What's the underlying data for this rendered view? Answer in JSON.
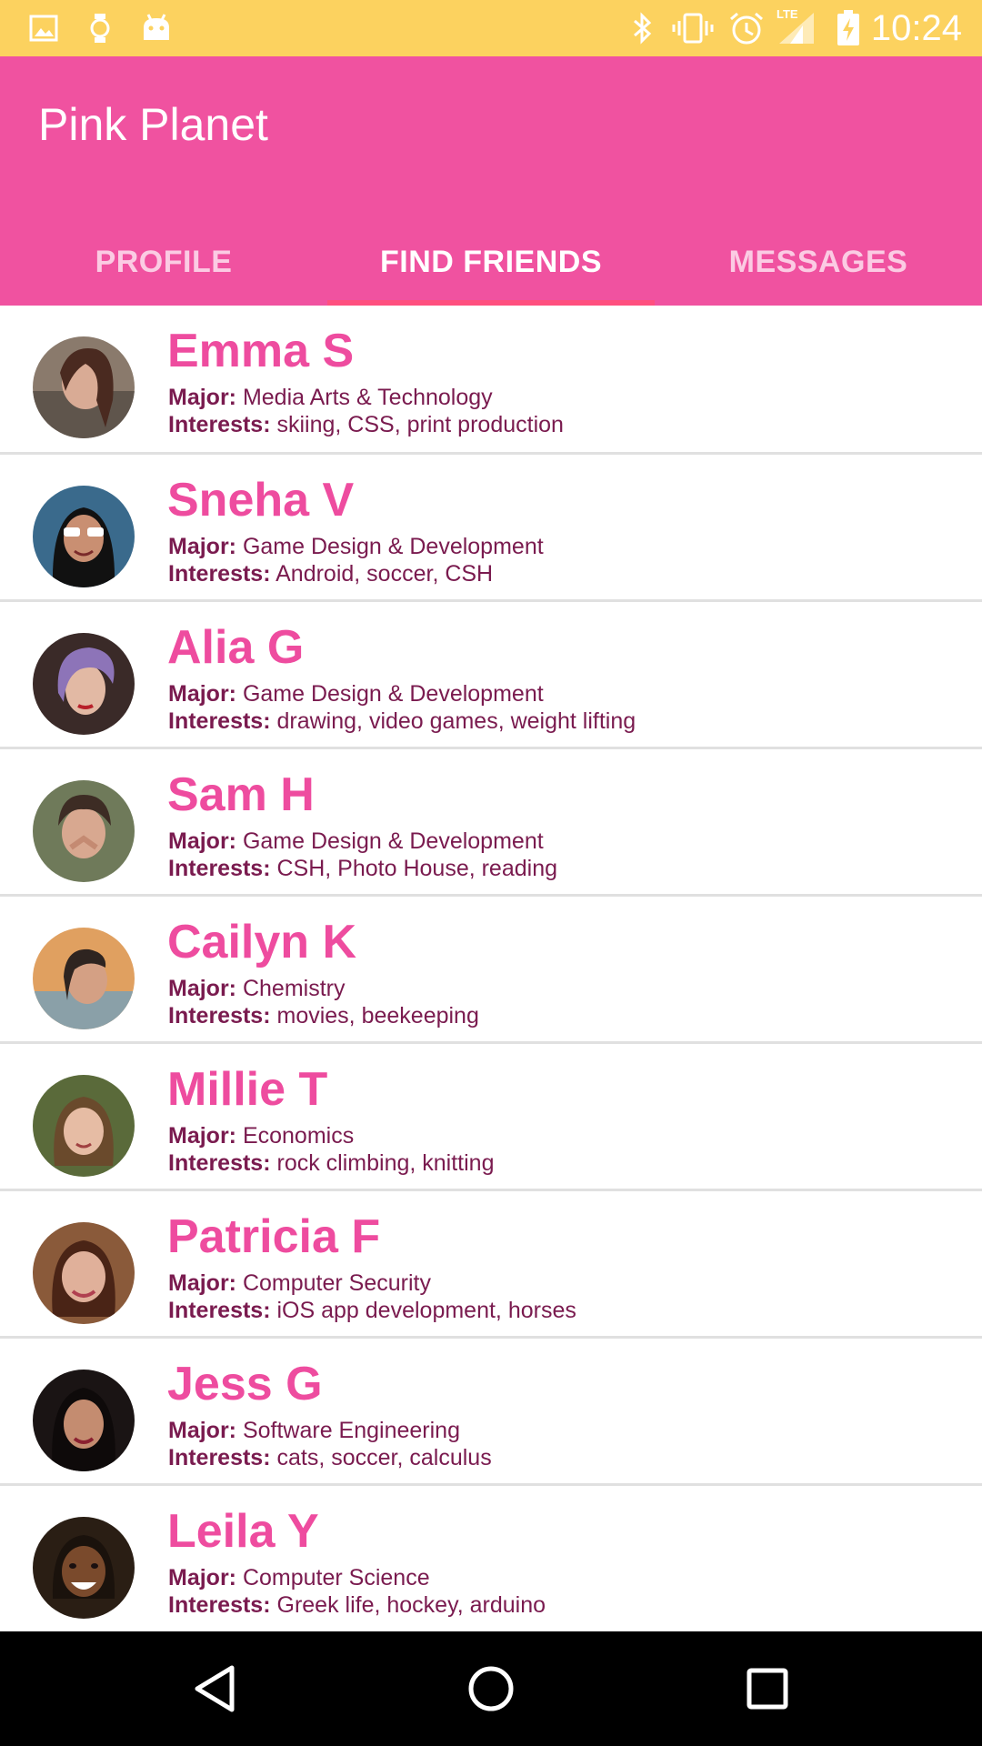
{
  "status_bar": {
    "time": "10:24",
    "icons": [
      "image-icon",
      "watch-icon",
      "android-icon",
      "bluetooth-icon",
      "vibrate-icon",
      "alarm-icon",
      "lte-signal-icon",
      "battery-charging-icon"
    ],
    "network_label": "LTE"
  },
  "app_bar": {
    "title": "Pink Planet",
    "tabs": [
      {
        "label": "PROFILE",
        "active": false
      },
      {
        "label": "FIND FRIENDS",
        "active": true
      },
      {
        "label": "MESSAGES",
        "active": false
      }
    ]
  },
  "labels": {
    "major": "Major:",
    "interests": "Interests:"
  },
  "friends": [
    {
      "name": "Emma S",
      "major": "Media Arts & Technology",
      "interests": "skiing, CSS, print production"
    },
    {
      "name": "Sneha V",
      "major": "Game Design & Development",
      "interests": "Android, soccer, CSH"
    },
    {
      "name": "Alia G",
      "major": "Game Design & Development",
      "interests": "drawing, video games, weight lifting"
    },
    {
      "name": "Sam H",
      "major": "Game Design & Development",
      "interests": "CSH, Photo House, reading"
    },
    {
      "name": "Cailyn K",
      "major": "Chemistry",
      "interests": "movies, beekeeping"
    },
    {
      "name": "Millie T",
      "major": "Economics",
      "interests": "rock climbing, knitting"
    },
    {
      "name": "Patricia F",
      "major": "Computer Security",
      "interests": "iOS app development, horses"
    },
    {
      "name": "Jess G",
      "major": "Software Engineering",
      "interests": "cats, soccer, calculus"
    },
    {
      "name": "Leila Y",
      "major": "Computer Science",
      "interests": "Greek life, hockey, arduino"
    }
  ],
  "nav_bar": {
    "buttons": [
      "back-icon",
      "home-icon",
      "recents-icon"
    ]
  },
  "colors": {
    "status_bar": "#fcd25f",
    "app_bar": "#f052a0",
    "tab_indicator": "#ff4f7f",
    "name_text": "#ee4c9f",
    "info_text": "#7a1b4f",
    "divider": "#e0e0e0"
  }
}
